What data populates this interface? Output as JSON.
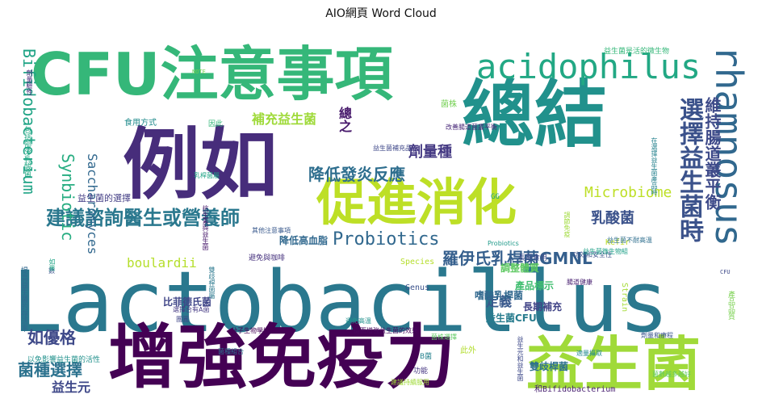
{
  "chart_data": {
    "type": "wordcloud",
    "title": "AIO網頁 Word Cloud",
    "colormap": "viridis",
    "words": [
      {
        "text": "Lactobacillus",
        "weight": 100,
        "color": "#2a788e"
      },
      {
        "text": "例如",
        "weight": 92,
        "color": "#472d7b"
      },
      {
        "text": "總結",
        "weight": 86,
        "color": "#21918c"
      },
      {
        "text": "增強免疫力",
        "weight": 80,
        "color": "#440154"
      },
      {
        "text": "CFU注意事項",
        "weight": 74,
        "color": "#35b779"
      },
      {
        "text": "益生菌",
        "weight": 70,
        "color": "#a0da39"
      },
      {
        "text": "促進消化",
        "weight": 64,
        "color": "#bddf26"
      },
      {
        "text": "acidophilus",
        "weight": 52,
        "color": "#22a884"
      },
      {
        "text": "rhamnosus",
        "weight": 48,
        "color": "#31688e"
      },
      {
        "text": "選擇益生菌時",
        "weight": 40,
        "color": "#3b528b"
      },
      {
        "text": "建議諮詢醫生或營養師",
        "weight": 32,
        "color": "#2a788e"
      },
      {
        "text": "Probiotics",
        "weight": 28,
        "color": "#31688e"
      },
      {
        "text": "Bifidobacterium",
        "weight": 26,
        "color": "#20a486"
      },
      {
        "text": "Synbiotic",
        "weight": 24,
        "color": "#27ad81"
      },
      {
        "text": "維持腸道叢平衡",
        "weight": 24,
        "color": "#3e4a89"
      },
      {
        "text": "羅伊氏乳桿菌GMNL",
        "weight": 22,
        "color": "#355f8d"
      },
      {
        "text": "降低發炎反應",
        "weight": 22,
        "color": "#2e6e8e"
      },
      {
        "text": "劑量種",
        "weight": 20,
        "color": "#443983"
      },
      {
        "text": "乳酸菌",
        "weight": 20,
        "color": "#3b528b"
      },
      {
        "text": "菌種選擇",
        "weight": 20,
        "color": "#2c728e"
      },
      {
        "text": "如優格",
        "weight": 20,
        "color": "#3e4989"
      },
      {
        "text": "Saccharomyces",
        "weight": 18,
        "color": "#31688e"
      },
      {
        "text": "Microbiome",
        "weight": 18,
        "color": "#bddf26"
      },
      {
        "text": "boulardii",
        "weight": 17,
        "color": "#b5de2b"
      },
      {
        "text": "補充益生菌",
        "weight": 17,
        "color": "#9fda3a"
      },
      {
        "text": "總之",
        "weight": 17,
        "color": "#481a6c"
      },
      {
        "text": "定義",
        "weight": 16,
        "color": "#38588c"
      },
      {
        "text": "益生元",
        "weight": 16,
        "color": "#3f4889"
      },
      {
        "text": "嗜酸乳桿菌",
        "weight": 12,
        "color": "#31688e"
      },
      {
        "text": "長期補充",
        "weight": 12,
        "color": "#414487"
      },
      {
        "text": "益生菌CFU",
        "weight": 12,
        "color": "#287c8e"
      },
      {
        "text": "雙歧桿菌",
        "weight": 11,
        "color": "#2d708e"
      },
      {
        "text": "比菲德氏菌",
        "weight": 11,
        "color": "#404688"
      },
      {
        "text": "降低高血脂",
        "weight": 11,
        "color": "#30688e"
      },
      {
        "text": "調整體質",
        "weight": 11,
        "color": "#5ec962"
      },
      {
        "text": "產品標示",
        "weight": 11,
        "color": "#42be71"
      },
      {
        "text": "益生菌的選擇",
        "weight": 10,
        "color": "#433e85"
      },
      {
        "text": "和Bifidobacterium",
        "weight": 9,
        "color": "#481f70"
      },
      {
        "text": "食用方式",
        "weight": 9,
        "color": "#228c8d"
      },
      {
        "text": "菌株",
        "weight": 9,
        "color": "#75d054"
      },
      {
        "text": "包括部分乳酸菌",
        "weight": 8,
        "color": "#22a884"
      },
      {
        "text": "Kefir",
        "weight": 8,
        "color": "#bddf26"
      },
      {
        "text": "Species",
        "weight": 8,
        "color": "#b5de2b"
      },
      {
        "text": "Genus",
        "weight": 8,
        "color": "#3b528b"
      },
      {
        "text": "Strain",
        "weight": 8,
        "color": "#a5db36"
      },
      {
        "text": "此外",
        "weight": 8,
        "color": "#b2dd2d"
      },
      {
        "text": "劑量和療程",
        "weight": 7,
        "color": "#3a548c"
      },
      {
        "text": "產品品質",
        "weight": 7,
        "color": "#7ad151"
      },
      {
        "text": "功能",
        "weight": 7,
        "color": "#453581"
      },
      {
        "text": "避免與咖啡",
        "weight": 7,
        "color": "#46327e"
      },
      {
        "text": "長期食用",
        "weight": 7,
        "color": "#3e4a89"
      },
      {
        "text": "B菌",
        "weight": 7,
        "color": "#26828e"
      },
      {
        "text": "因此",
        "weight": 7,
        "color": "#35b779"
      },
      {
        "text": "GG",
        "weight": 7,
        "color": "#20a486"
      },
      {
        "text": "提高益生菌的存活率",
        "weight": 6,
        "color": "#31688e"
      },
      {
        "text": "以免影響益生菌的活性",
        "weight": 6,
        "color": "#21918c"
      },
      {
        "text": "益生菌是活的微生物",
        "weight": 6,
        "color": "#35b779"
      },
      {
        "text": "功效和安全性",
        "weight": 5,
        "color": "#3b528b"
      },
      {
        "text": "分子生物學技術",
        "weight": 5,
        "color": "#440154"
      },
      {
        "text": "從而增強益生菌的效果",
        "weight": 5,
        "color": "#46085c"
      },
      {
        "text": "菌株選擇",
        "weight": 5,
        "color": "#5ec962"
      },
      {
        "text": "團圓",
        "weight": 5,
        "color": "#404688"
      },
      {
        "text": "數",
        "weight": 5,
        "color": "#3b528b"
      },
      {
        "text": "如果",
        "weight": 5,
        "color": "#20a486"
      },
      {
        "text": "其他注意事項",
        "weight": 5,
        "color": "#38588c"
      },
      {
        "text": "改善腸道菌叢平衡",
        "weight": 5,
        "color": "#482878"
      },
      {
        "text": "益生菌不耐高溫",
        "weight": 5,
        "color": "#2e6e8e"
      },
      {
        "text": "益生菌微生物組",
        "weight": 5,
        "color": "#1fa088"
      },
      {
        "text": "抗生素與益生菌",
        "weight": 5,
        "color": "#481a6c"
      },
      {
        "text": "在選擇益生菌產品時",
        "weight": 5,
        "color": "#26828e"
      },
      {
        "text": "劑量驗性",
        "weight": 5,
        "color": "#472d7b"
      },
      {
        "text": "避免高溫",
        "weight": 5,
        "color": "#21918c"
      },
      {
        "text": "調節免疫",
        "weight": 5,
        "color": "#9fda3a"
      },
      {
        "text": "選擇合有A菌",
        "weight": 5,
        "color": "#443983"
      },
      {
        "text": "益生元和益生菌",
        "weight": 5,
        "color": "#3e4989"
      },
      {
        "text": "雙歧桿菌屬",
        "weight": 5,
        "color": "#2a788e"
      },
      {
        "text": "菌種組合",
        "weight": 5,
        "color": "#2c728e"
      },
      {
        "text": "腸道健康",
        "weight": 5,
        "color": "#481f70"
      },
      {
        "text": "乳桿菌屬",
        "weight": 5,
        "color": "#20a486"
      },
      {
        "text": "建議持續服用",
        "weight": 5,
        "color": "#a0da39"
      },
      {
        "text": "菌數越多越好",
        "weight": 5,
        "color": "#5ec962"
      },
      {
        "text": "益生菌補充品",
        "weight": 5,
        "color": "#3f4889"
      },
      {
        "text": "適量攝取",
        "weight": 5,
        "color": "#23898e"
      },
      {
        "text": "Probiotics",
        "weight": 4,
        "color": "#1f9a8a"
      },
      {
        "text": "CFU",
        "weight": 4,
        "color": "#3e4a89"
      },
      {
        "text": "NOTE",
        "weight": 4,
        "color": "#75d054"
      }
    ]
  }
}
